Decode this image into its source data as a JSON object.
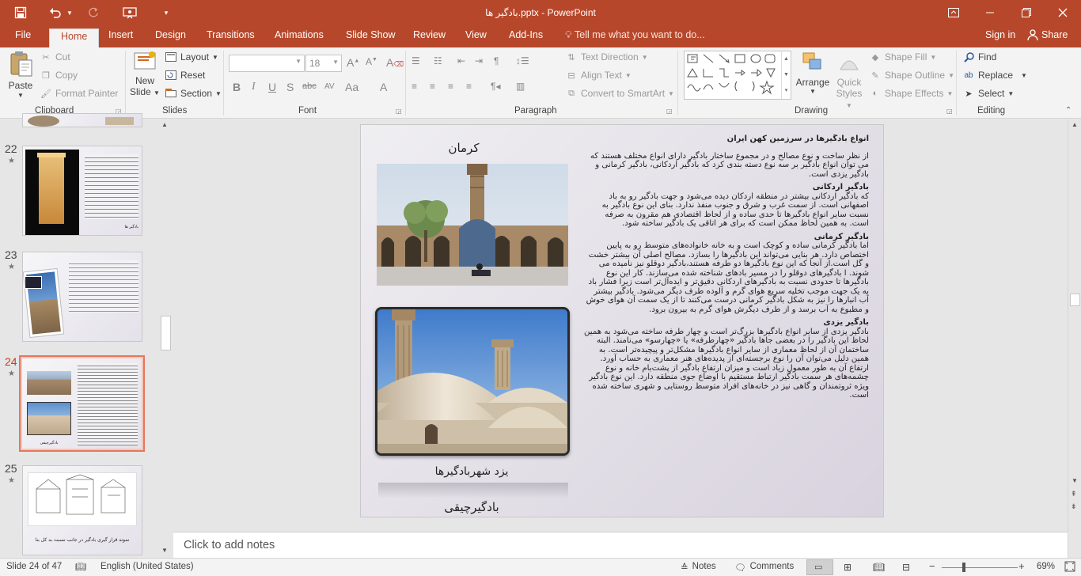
{
  "window": {
    "title": "بادگیر ها.pptx - PowerPoint"
  },
  "tabs": {
    "file": "File",
    "home": "Home",
    "insert": "Insert",
    "design": "Design",
    "transitions": "Transitions",
    "animations": "Animations",
    "slideshow": "Slide Show",
    "review": "Review",
    "view": "View",
    "addins": "Add-Ins",
    "tellme": "Tell me what you want to do...",
    "signin": "Sign in",
    "share": "Share"
  },
  "ribbon": {
    "clipboard": {
      "label": "Clipboard",
      "paste": "Paste",
      "cut": "Cut",
      "copy": "Copy",
      "format_painter": "Format Painter"
    },
    "slides": {
      "label": "Slides",
      "new_slide_1": "New",
      "new_slide_2": "Slide",
      "layout": "Layout",
      "reset": "Reset",
      "section": "Section"
    },
    "font": {
      "label": "Font",
      "size": "18"
    },
    "paragraph": {
      "label": "Paragraph",
      "text_direction": "Text Direction",
      "align_text": "Align Text",
      "convert_smartart": "Convert to SmartArt"
    },
    "drawing": {
      "label": "Drawing",
      "arrange": "Arrange",
      "quick_styles_1": "Quick",
      "quick_styles_2": "Styles",
      "shape_fill": "Shape Fill",
      "shape_outline": "Shape Outline",
      "shape_effects": "Shape Effects"
    },
    "editing": {
      "label": "Editing",
      "find": "Find",
      "replace": "Replace",
      "select": "Select"
    }
  },
  "thumbnails": [
    {
      "num": "22",
      "caption": "بادگیر ها"
    },
    {
      "num": "23",
      "caption": ""
    },
    {
      "num": "24",
      "caption": "بادگیرچیقی"
    },
    {
      "num": "25",
      "caption": "نمونه قرار گیری بادگیر در جانب نسبت به کل بنا"
    }
  ],
  "slide": {
    "heading": "انواع بادگیرها در سرزمین کهن ایران",
    "intro": "از نظر ساخت و نوع مصالح و در مجموع ساختار بادگیر دارای انواع مختلف هستند که می توان انواع بادگیر بر سه نوع دسته بندی کرد که بادگیر اردکانی، بادگیر کرمانی و بادگیر یزدی است.",
    "h1": "بادگیر اردکانی",
    "p1": "که بادگیر اردکانی بیشتر در منطقه اردکان دیده می‌شود و جهت بادگیر رو به باد اصفهانی است. از سمت غرب و شرق و جنوب منفذ ندارد. بنای این نوع بادگیر به نسبت سایر انواع بادگیرها تا حدی ساده و از لحاظ اقتصادی هم مقرون به صرفه است. به همین لحاظ ممکن است که برای هر اتاقی یک بادگیر ساخته شود.",
    "h2": "بادگیر کرمانی",
    "p2": "اما بادگیر کرمانی ساده و کوچک است و به خانه خانواده‌های متوسط رو به پایین اختصاص دارد. هر بنایی می‌تواند این بادگیرها را بسازد. مصالح اصلی آن بیشتر خشت و گل است.از آنجا که این نوع بادگیرها دو طرفه هستند،بادگیر دوقلو نیز نامیده می شوند. ا بادگیرهای دوقلو را در مسیر بادهای شناخته شده می‌سازند. کار این نوع بادگیرها تا حدودی نسبت به بادگیرهای اردکانی دقیق‌تر و ایده‌آل‌تر است زیرا فشار باد به یک جهت موجب تخلیه سریع هوای گرم و آلوده طرف دیگر می‌شود. بادگیر بیشتر آب انبارها را نیز به شکل بادگیر کرمانی درست می‌کنند تا از یک سمت آن هوای خوش و مطبوع به آب برسد و از طرف دیگرش هوای گرم به بیرون برود.",
    "h3": "بادگیر یزدی",
    "p3": "بادگیر یزدی از سایر انواع بادگیرها بزرگ‌تر است و چهار طرفه ساخته می‌شود به همین لحاظ این بادگیر را در بعضی جاها بادگیر «چهارطرفه» یا «چهارسو» می‌نامند. البته ساختمان آن از لحاظ معماری از سایر انواع بادگیرها مشکل‌تر و پیچیده‌تر است. به همین دلیل می‌توان آن را نوع برجسته‌ای از پدیده‌های هنر معماری به حساب آورد. ارتفاع آن به طور معمول زیاد است و میزان ارتفاع بادگیر از پشت‌بام خانه و نوع چشمه‌های هر سمت بادگیر ارتباط مستقیم با اوضاع جوی منطقه دارد. این نوع بادگیر ویژه ثروتمندان و گاهی نیز در خانه‌های افراد متوسط روستایی و شهری ساخته شده است.",
    "caption_top": "کرمان",
    "caption_mid": "یزد شهربادگیرها",
    "caption_bottom": "بادگیرچیقی"
  },
  "notes": {
    "placeholder": "Click to add notes"
  },
  "status": {
    "slide_of": "Slide 24 of 47",
    "language": "English (United States)",
    "notes": "Notes",
    "comments": "Comments",
    "zoom": "69%"
  },
  "colors": {
    "accent": "#b7472a",
    "selected_thumb": "#e8765a"
  }
}
